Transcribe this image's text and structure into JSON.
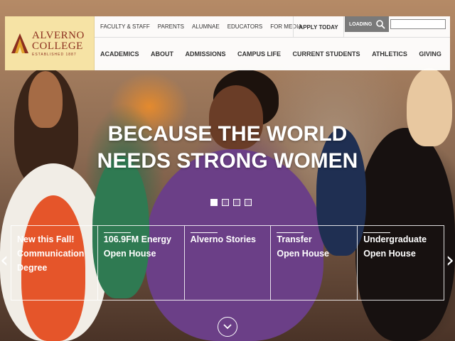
{
  "brand": {
    "name": "ALVERNO COLLEGE",
    "name_line1": "ALVERNO",
    "name_line2": "COLLEGE",
    "established": "ESTABLISHED 1887",
    "color": "#8c2f1f",
    "logo_bg": "#f6e3a5"
  },
  "utility_nav": [
    "FACULTY & STAFF",
    "PARENTS",
    "ALUMNAE",
    "EDUCATORS",
    "FOR MEDIA"
  ],
  "apply_label": "APPLY TODAY",
  "search": {
    "label": "LOADING",
    "icon": "search-icon",
    "value": ""
  },
  "main_nav": [
    "ACADEMICS",
    "ABOUT",
    "ADMISSIONS",
    "CAMPUS LIFE",
    "CURRENT STUDENTS",
    "ATHLETICS",
    "GIVING"
  ],
  "hero": {
    "headline_line1": "BECAUSE THE WORLD",
    "headline_line2": "NEEDS STRONG WOMEN",
    "slide_count": 4,
    "active_slide": 1
  },
  "tiles": [
    "New this Fall!\nCommunication\nDegree",
    "106.9FM Energy\nOpen House",
    "Alverno Stories",
    "Transfer\nOpen House",
    "Undergraduate\nOpen House"
  ],
  "controls": {
    "prev_icon": "chevron-left-icon",
    "next_icon": "chevron-right-icon",
    "scroll_icon": "chevron-down-circle-icon"
  }
}
